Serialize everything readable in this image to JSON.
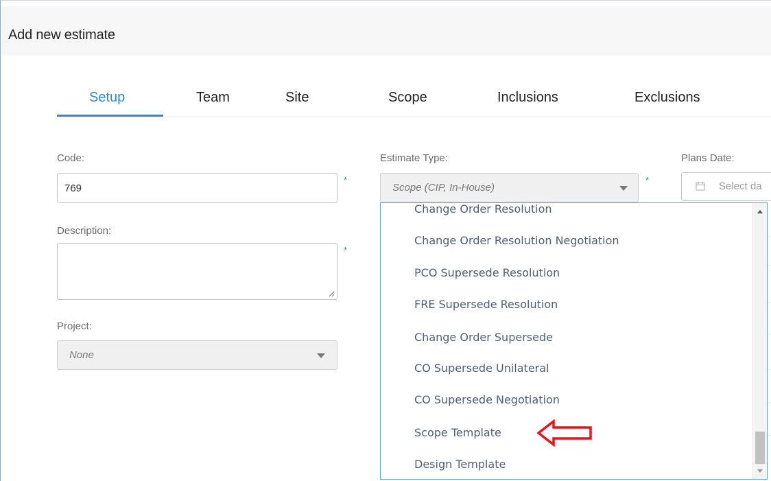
{
  "dialog": {
    "title": "Add new estimate"
  },
  "tabs": [
    {
      "label": "Setup",
      "active": true
    },
    {
      "label": "Team",
      "active": false
    },
    {
      "label": "Site",
      "active": false
    },
    {
      "label": "Scope",
      "active": false
    },
    {
      "label": "Inclusions",
      "active": false
    },
    {
      "label": "Exclusions",
      "active": false
    }
  ],
  "form": {
    "code": {
      "label": "Code:",
      "value": "769",
      "required_mark": "*"
    },
    "description": {
      "label": "Description:",
      "value": "",
      "required_mark": "*"
    },
    "project": {
      "label": "Project:",
      "value": "None"
    },
    "estimate_type": {
      "label": "Estimate Type:",
      "value": "Scope (CIP, In-House)",
      "required_mark": "*"
    },
    "plans_date": {
      "label": "Plans Date:",
      "placeholder": "Select da"
    }
  },
  "dropdown": {
    "options": [
      "Change Order Resolution",
      "Change Order Resolution Negotiation",
      "PCO Supersede Resolution",
      "FRE Supersede Resolution",
      "Change Order Supersede",
      "CO Supersede Unilateral",
      "CO Supersede Negotiation",
      "Scope Template",
      "Design Template"
    ],
    "highlighted_option": "Scope Template"
  },
  "colors": {
    "accent": "#2e8bc9",
    "annotation_arrow": "#e8141c",
    "dropdown_border": "#5ea3d6"
  },
  "icons": {
    "calendar": "calendar-icon",
    "select_caret": "chevron-down-icon",
    "annotation": "left-arrow-annotation-icon"
  }
}
